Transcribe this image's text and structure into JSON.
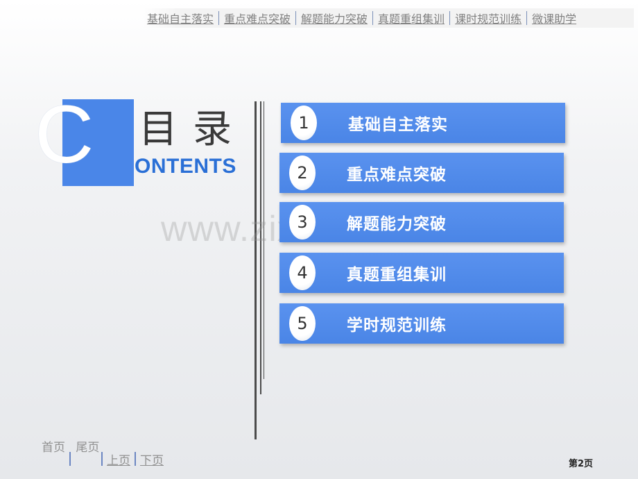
{
  "top_nav": {
    "items": [
      {
        "label": "基础自主落实"
      },
      {
        "label": "重点难点突破"
      },
      {
        "label": "解题能力突破"
      },
      {
        "label": "真题重组集训"
      },
      {
        "label": "课时规范训练"
      },
      {
        "label": "微课助学"
      }
    ]
  },
  "header": {
    "logo_letter": "C",
    "title_cn": "目录",
    "title_en": "ONTENTS"
  },
  "watermark": "www.zixin.com.cn",
  "menu": {
    "items": [
      {
        "num": "1",
        "label": "基础自主落实"
      },
      {
        "num": "2",
        "label": "重点难点突破"
      },
      {
        "num": "3",
        "label": "解题能力突破"
      },
      {
        "num": "4",
        "label": "真题重组集训"
      },
      {
        "num": "5",
        "label": "学时规范训练"
      }
    ]
  },
  "footer": {
    "first_page": "首页",
    "last_page": "尾页",
    "prev_page": "上页",
    "next_page": "下页",
    "page_number": "第2页"
  },
  "colors": {
    "accent": "#4a86e8",
    "heading_blue": "#2a6fd6"
  }
}
